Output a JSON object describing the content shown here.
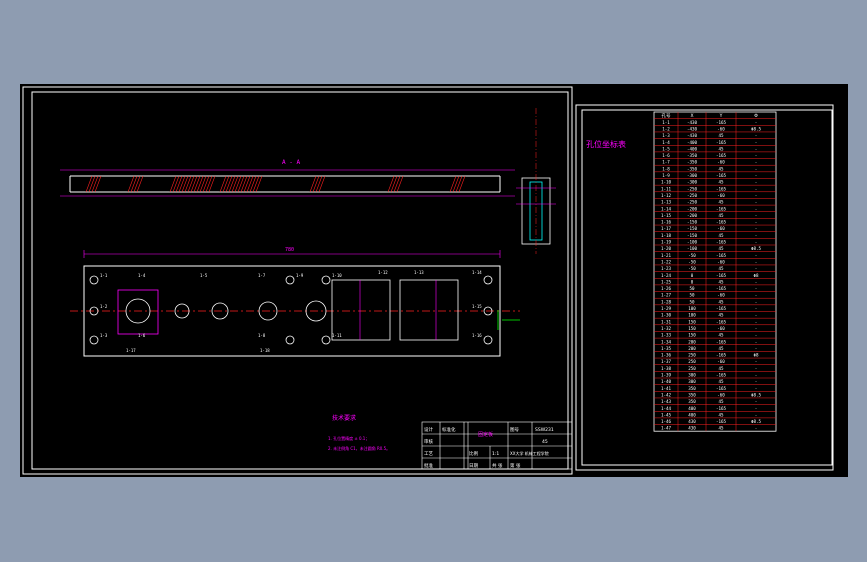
{
  "window": {
    "background": "#8e9cb1"
  },
  "colors": {
    "frame": "#ffffff",
    "dim": "#ff00ff",
    "center": "#ff2020",
    "hatch": "#ff2020",
    "part": "#ffffff",
    "grid": "#ff2020",
    "cyan": "#00ffff",
    "green": "#00ff00",
    "yellow": "#ffff00"
  },
  "sheet_left": {
    "section_label": "A - A",
    "overall_dim": "780",
    "tech_title": "技术要求",
    "tech_notes": [
      "1. 孔位置精度 ± 0.1；",
      "2. 未注倒角 C1，未注圆角 R0.5。"
    ],
    "hole_labels": [
      "1-1",
      "1-2",
      "1-3",
      "1-4",
      "1-5",
      "1-6",
      "1-7",
      "1-8",
      "1-9",
      "1-10",
      "1-11",
      "1-12",
      "1-13",
      "1-14",
      "1-15",
      "1-16",
      "1-17",
      "1-18"
    ],
    "title_block": {
      "cells": [
        "设计",
        "比例",
        "批准",
        "审核",
        "标准化",
        "工艺",
        "日期",
        "1:1",
        "图号",
        "共 张",
        "第 张"
      ],
      "drawing_name": "固定板",
      "drawing_no": "SSW231",
      "material": "45",
      "company": "XX大学 机械工程学院"
    }
  },
  "sheet_right": {
    "title": "孔位坐标表",
    "table": {
      "headers": [
        "孔号",
        "X",
        "Y",
        "Φ"
      ],
      "rows": [
        [
          "1-1",
          "-430",
          "-165",
          "-"
        ],
        [
          "1-2",
          "-430",
          "-60",
          "Φ8.5"
        ],
        [
          "1-3",
          "-430",
          "45",
          "-"
        ],
        [
          "1-4",
          "-400",
          "-165",
          "-"
        ],
        [
          "1-5",
          "-400",
          "45",
          "-"
        ],
        [
          "1-6",
          "-350",
          "-165",
          "-"
        ],
        [
          "1-7",
          "-350",
          "-60",
          "-"
        ],
        [
          "1-8",
          "-350",
          "45",
          "-"
        ],
        [
          "1-9",
          "-300",
          "-165",
          "-"
        ],
        [
          "1-10",
          "-300",
          "45",
          "-"
        ],
        [
          "1-11",
          "-250",
          "-165",
          "-"
        ],
        [
          "1-12",
          "-250",
          "-60",
          "-"
        ],
        [
          "1-13",
          "-250",
          "45",
          "-"
        ],
        [
          "1-14",
          "-200",
          "-165",
          "-"
        ],
        [
          "1-15",
          "-200",
          "45",
          "-"
        ],
        [
          "1-16",
          "-150",
          "-165",
          "-"
        ],
        [
          "1-17",
          "-150",
          "-60",
          "-"
        ],
        [
          "1-18",
          "-150",
          "45",
          "-"
        ],
        [
          "1-19",
          "-100",
          "-165",
          "-"
        ],
        [
          "1-20",
          "-100",
          "45",
          "Φ8.5"
        ],
        [
          "1-21",
          "-50",
          "-165",
          "-"
        ],
        [
          "1-22",
          "-50",
          "-60",
          "-"
        ],
        [
          "1-23",
          "-50",
          "45",
          "-"
        ],
        [
          "1-24",
          "0",
          "-165",
          "Φ8"
        ],
        [
          "1-25",
          "0",
          "45",
          "-"
        ],
        [
          "1-26",
          "50",
          "-165",
          "-"
        ],
        [
          "1-27",
          "50",
          "-60",
          "-"
        ],
        [
          "1-28",
          "50",
          "45",
          "-"
        ],
        [
          "1-29",
          "100",
          "-165",
          "-"
        ],
        [
          "1-30",
          "100",
          "45",
          "-"
        ],
        [
          "1-31",
          "150",
          "-165",
          "-"
        ],
        [
          "1-32",
          "150",
          "-60",
          "-"
        ],
        [
          "1-33",
          "150",
          "45",
          "-"
        ],
        [
          "1-34",
          "200",
          "-165",
          "-"
        ],
        [
          "1-35",
          "200",
          "45",
          "-"
        ],
        [
          "1-36",
          "250",
          "-165",
          "Φ8"
        ],
        [
          "1-37",
          "250",
          "-60",
          "-"
        ],
        [
          "1-38",
          "250",
          "45",
          "-"
        ],
        [
          "1-39",
          "300",
          "-165",
          "-"
        ],
        [
          "1-40",
          "300",
          "45",
          "-"
        ],
        [
          "1-41",
          "350",
          "-165",
          "-"
        ],
        [
          "1-42",
          "350",
          "-60",
          "Φ8.5"
        ],
        [
          "1-43",
          "350",
          "45",
          "-"
        ],
        [
          "1-44",
          "400",
          "-165",
          "-"
        ],
        [
          "1-45",
          "400",
          "45",
          "-"
        ],
        [
          "1-46",
          "430",
          "-165",
          "Φ8.5"
        ],
        [
          "1-47",
          "430",
          "45",
          "-"
        ]
      ]
    }
  }
}
